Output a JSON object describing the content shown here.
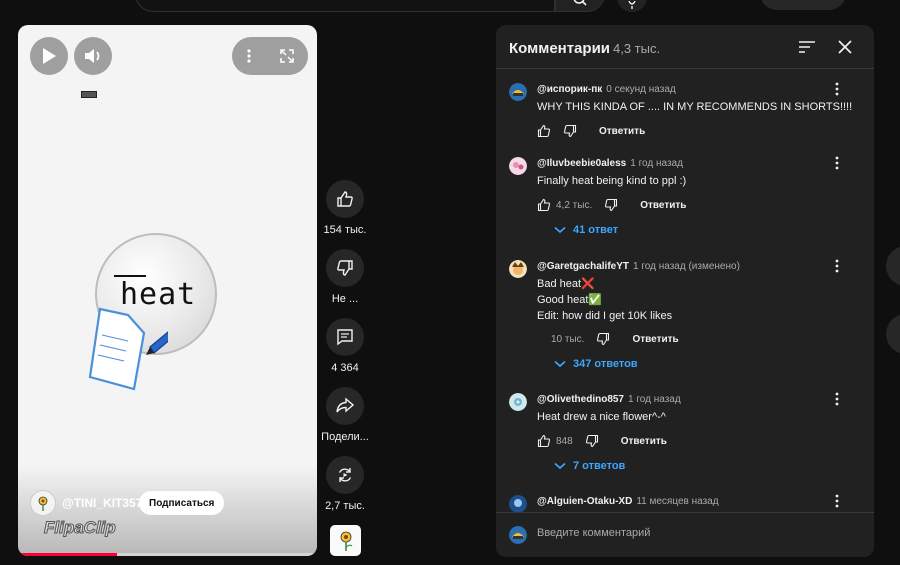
{
  "player": {
    "video_word": "heat",
    "channel_name": "@TINI_KIT357",
    "subscribe_label": "Подписаться",
    "watermark": "FlipaClip",
    "progress": 0.33
  },
  "actions": {
    "like_count": "154 тыс.",
    "dislike_label": "Не ...",
    "comments_count": "4 364",
    "share_label": "Подели...",
    "remix_count": "2,7 тыс."
  },
  "comments_panel": {
    "title": "Комментарии",
    "count": "4,3 тыс.",
    "reply_label": "Ответить",
    "input_placeholder": "Введите комментарий",
    "comments": [
      {
        "author": "@испорик-пк",
        "time": "0 секунд назад",
        "lines": [
          "WHY THIS KINDA OF .... IN MY RECOMMENDS IN SHORTS!!!!"
        ],
        "likes": "",
        "replies": ""
      },
      {
        "author": "@Iluvbeebie0aless",
        "time": "1 год назад",
        "lines": [
          "Finally heat being kind to ppl :)"
        ],
        "likes": "4,2 тыс.",
        "replies": "41 ответ"
      },
      {
        "author": "@GaretgachalifeYT",
        "time": "1 год назад (изменено)",
        "lines": [
          "Bad heat❌",
          "Good heat✅",
          "Edit: how did I get 10K likes"
        ],
        "likes": "10 тыс.",
        "replies": "347 ответов"
      },
      {
        "author": "@Olivethedino857",
        "time": "1 год назад",
        "lines": [
          "Heat drew a nice flower^-^"
        ],
        "likes": "848",
        "replies": "7 ответов"
      },
      {
        "author": "@Alguien-Otaku-XD",
        "time": "11 месяцев назад",
        "lines": [],
        "likes": "",
        "replies": ""
      }
    ]
  },
  "colors": {
    "background": "#0f0f0f",
    "panel": "#212121",
    "link": "#3ea6ff",
    "progress": "#ff0033"
  }
}
